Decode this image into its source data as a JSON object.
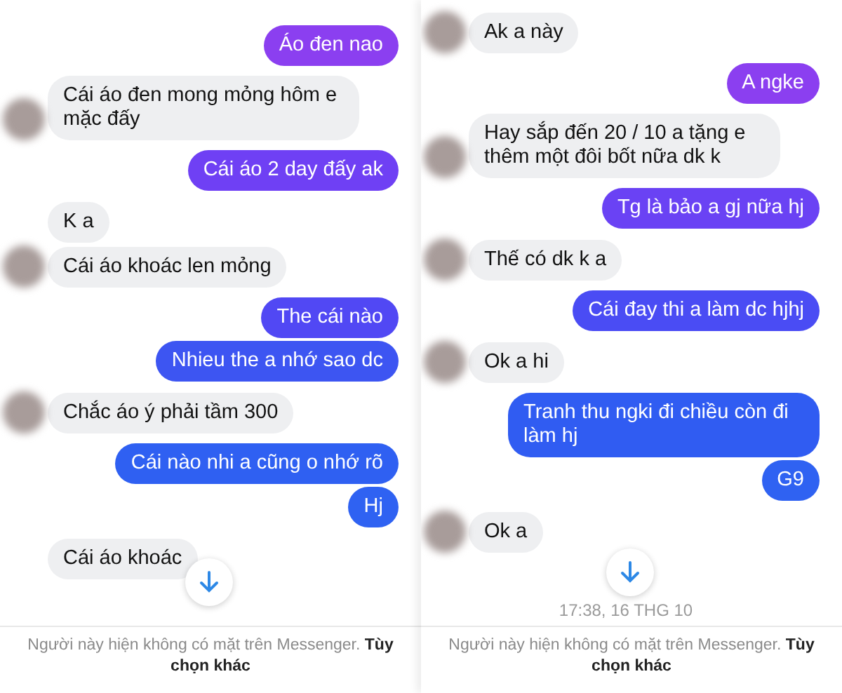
{
  "panels": [
    {
      "messages": [
        {
          "kind": "out",
          "text": "Áo đen nao",
          "color": "#8b3ff0"
        },
        {
          "kind": "in",
          "text": "Cái áo đen mong mỏng hôm e mặc đấy",
          "avatar": true
        },
        {
          "kind": "out",
          "text": "Cái áo 2 day đấy ak",
          "color": "#6f40f4"
        },
        {
          "kind": "in",
          "text": "K a",
          "avatar": false
        },
        {
          "kind": "in",
          "text": "Cái áo khoác len mỏng",
          "avatar": true
        },
        {
          "kind": "out",
          "text": "The cái nào",
          "color": "#5148f4"
        },
        {
          "kind": "out",
          "text": "Nhieu the a nhớ sao dc",
          "color": "#3d55f2"
        },
        {
          "kind": "in",
          "text": "Chắc áo ý phải tầm 300",
          "avatar": true
        },
        {
          "kind": "out",
          "text": "Cái nào nhi a cũng o nhớ rõ",
          "color": "#2f60f2"
        },
        {
          "kind": "out",
          "text": "Hj",
          "color": "#2f62f2"
        },
        {
          "kind": "in",
          "text": "Cái áo khoác",
          "avatar": false
        }
      ],
      "notice": "Người này hiện không có mặt trên Messenger. **Tùy chọn khác**"
    },
    {
      "messages": [
        {
          "kind": "in",
          "text": "Ak a này",
          "avatar": true
        },
        {
          "kind": "out",
          "text": "A ngke",
          "color": "#8b3ff0"
        },
        {
          "kind": "in",
          "text": "Hay sắp đến 20 /  10 a tặng e thêm một đôi bốt nữa dk k",
          "avatar": true
        },
        {
          "kind": "out",
          "text": "Tg là bảo a gj nữa hj",
          "color": "#6a42f4"
        },
        {
          "kind": "in",
          "text": "Thế có dk k a",
          "avatar": true
        },
        {
          "kind": "out",
          "text": "Cái đay thi a làm dc hjhj",
          "color": "#4a4cf4"
        },
        {
          "kind": "in",
          "text": "Ok a hi",
          "avatar": true
        },
        {
          "kind": "out",
          "text": "Tranh thu ngki đi chiều còn đi làm hj",
          "color": "#305cf2"
        },
        {
          "kind": "out",
          "text": "G9",
          "color": "#2f62f2"
        },
        {
          "kind": "in",
          "text": "Ok a",
          "avatar": true
        }
      ],
      "timestamp": "17:38, 16 THG 10",
      "notice": "Người này hiện không có mặt trên Messenger. **Tùy chọn khác**"
    }
  ]
}
